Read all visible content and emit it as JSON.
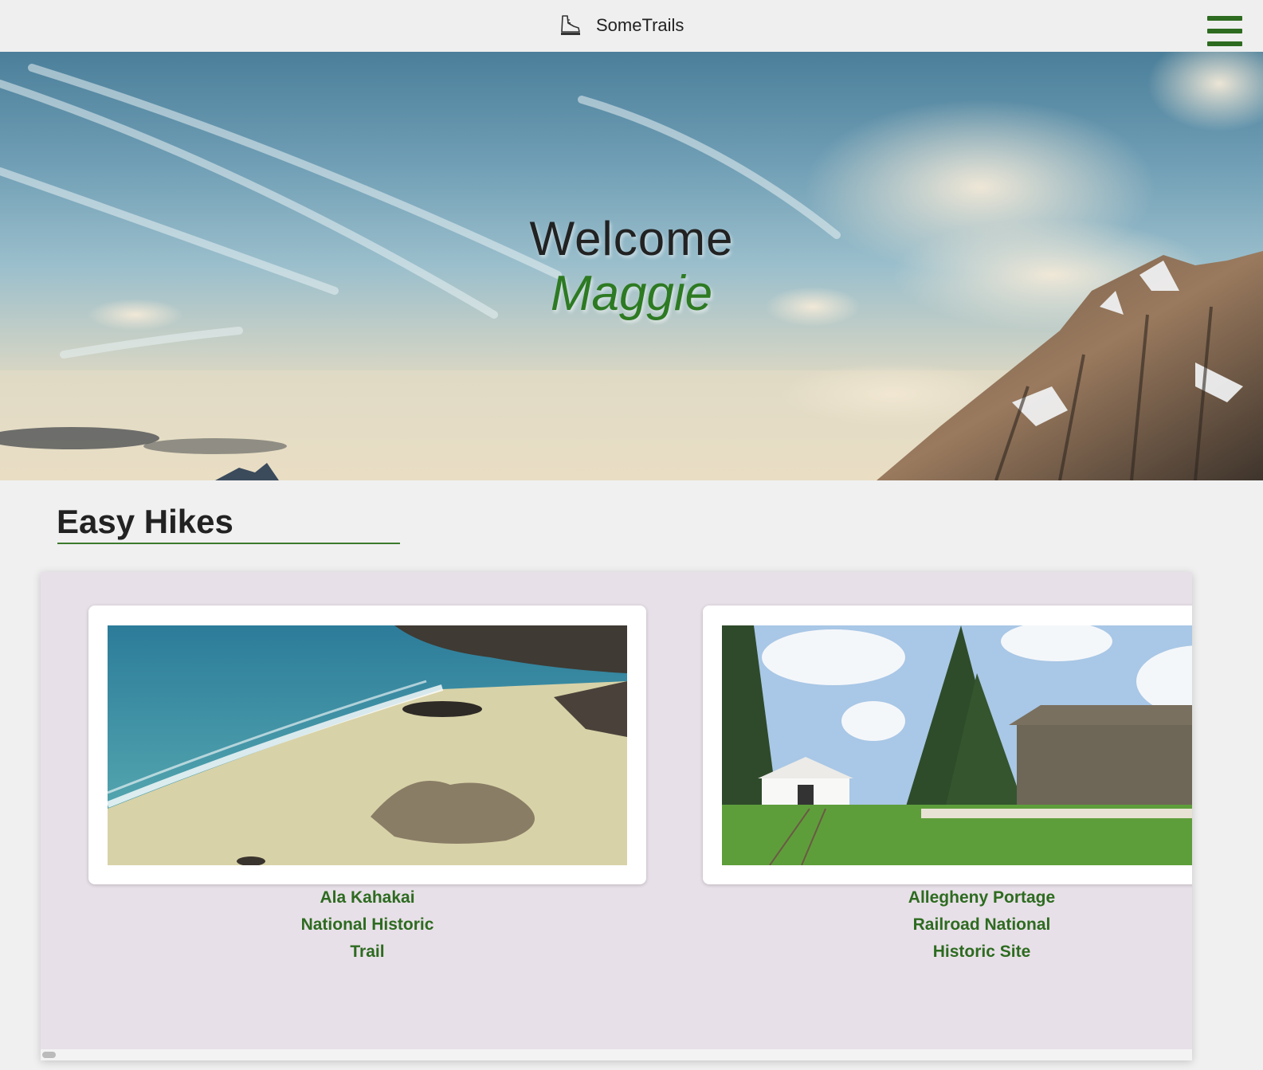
{
  "nav": {
    "brand": "SomeTrails",
    "brand_icon": "hiking-boot-icon",
    "menu_icon": "hamburger-menu-icon",
    "accent_color": "#2d6b20"
  },
  "hero": {
    "greeting": "Welcome",
    "user_name": "Maggie"
  },
  "section": {
    "title": "Easy Hikes"
  },
  "trails": [
    {
      "name": "Ala Kahakai\nNational Historic\nTrail"
    },
    {
      "name": "Allegheny Portage\nRailroad National\nHistoric Site"
    }
  ]
}
